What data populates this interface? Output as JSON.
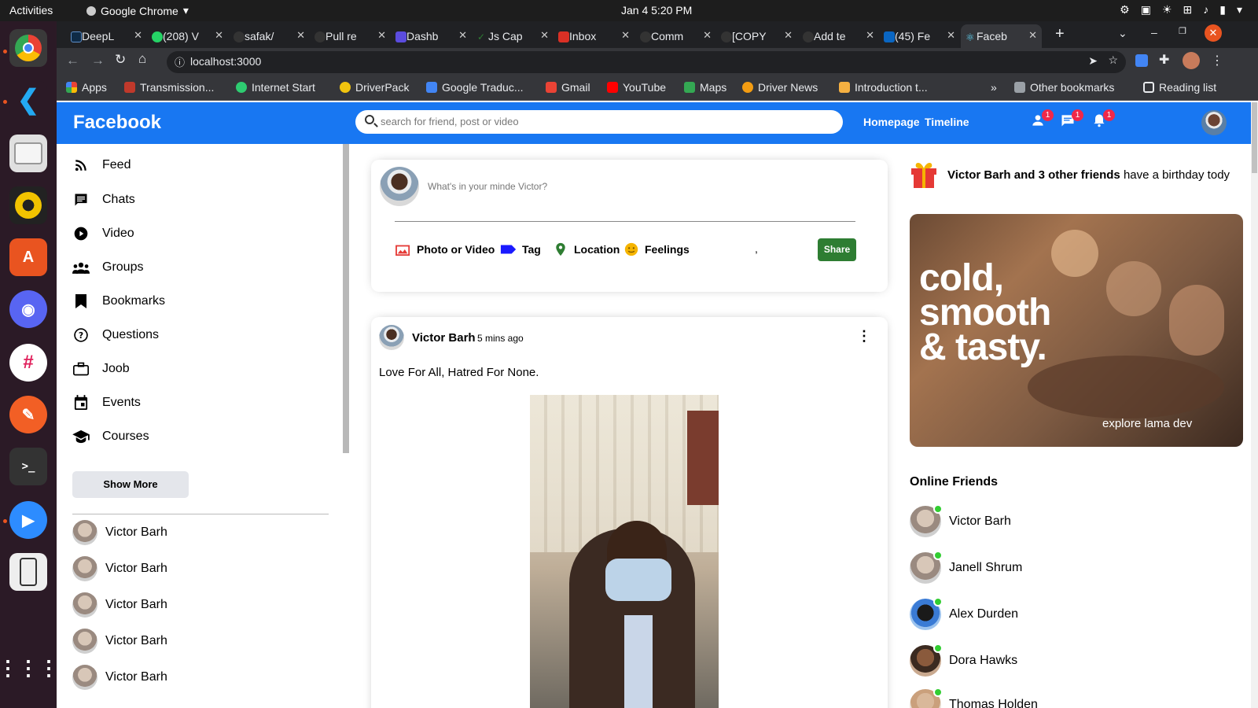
{
  "system": {
    "activities": "Activities",
    "app_name": "Google Chrome",
    "clock": "Jan 4   5:20 PM"
  },
  "browser": {
    "tabs": [
      {
        "label": "DeepL",
        "color": "#0f2b46"
      },
      {
        "label": "(208) V",
        "color": "#25d366"
      },
      {
        "label": "safak/",
        "color": "#333333"
      },
      {
        "label": "Pull re",
        "color": "#333333"
      },
      {
        "label": "Dashb",
        "color": "#5b4cde"
      },
      {
        "label": "Js Cap",
        "color": "#2e7d32"
      },
      {
        "label": "Inbox",
        "color": "#d93025"
      },
      {
        "label": "Comm",
        "color": "#333333"
      },
      {
        "label": "[COPY",
        "color": "#333333"
      },
      {
        "label": "Add te",
        "color": "#333333"
      },
      {
        "label": "(45) Fe",
        "color": "#0a66c2"
      },
      {
        "label": "Faceb",
        "color": "#61dafb"
      }
    ],
    "new_tab": "+",
    "url": "localhost:3000",
    "bookmarks": [
      {
        "label": "Apps",
        "color": "#e94235"
      },
      {
        "label": "Transmission...",
        "color": "#c0392b"
      },
      {
        "label": "Internet Start",
        "color": "#2ecc71"
      },
      {
        "label": "DriverPack",
        "color": "#f1c40f"
      },
      {
        "label": "Google Traduc...",
        "color": "#4285f4"
      },
      {
        "label": "Gmail",
        "color": "#ea4335"
      },
      {
        "label": "YouTube",
        "color": "#ff0000"
      },
      {
        "label": "Maps",
        "color": "#34a853"
      },
      {
        "label": "Driver News",
        "color": "#f39c12"
      },
      {
        "label": "Introduction t...",
        "color": "#f5b041"
      }
    ],
    "overflow": "»",
    "other_bookmarks": "Other bookmarks",
    "reading_list": "Reading list"
  },
  "fb": {
    "logo": "Facebook",
    "search_placeholder": "search for friend, post or video",
    "links": [
      "Homepage",
      "Timeline"
    ],
    "badges": [
      "1",
      "1",
      "1"
    ],
    "brand_color": "#1877f2"
  },
  "sidebar": {
    "items": [
      "Feed",
      "Chats",
      "Video",
      "Groups",
      "Bookmarks",
      "Questions",
      "Joob",
      "Events",
      "Courses"
    ],
    "show_more": "Show More",
    "friends": [
      "Victor Barh",
      "Victor Barh",
      "Victor Barh",
      "Victor Barh",
      "Victor Barh"
    ]
  },
  "share": {
    "placeholder": "What's in your minde Victor?",
    "options": [
      "Photo or Video",
      "Tag",
      "Location",
      "Feelings"
    ],
    "comma": ",",
    "button": "Share"
  },
  "post": {
    "author": "Victor Barh",
    "time": "5 mins ago",
    "text": "Love For All, Hatred For None."
  },
  "rightbar": {
    "bday_bold": "Victor Barh and 3 other friends",
    "bday_rest": " have a birthday tody",
    "ad_headline": [
      "cold,",
      "smooth",
      "& tasty."
    ],
    "ad_caption": "explore lama dev",
    "online_title": "Online Friends",
    "online": [
      "Victor Barh",
      "Janell Shrum",
      "Alex Durden",
      "Dora Hawks",
      "Thomas Holden"
    ]
  }
}
